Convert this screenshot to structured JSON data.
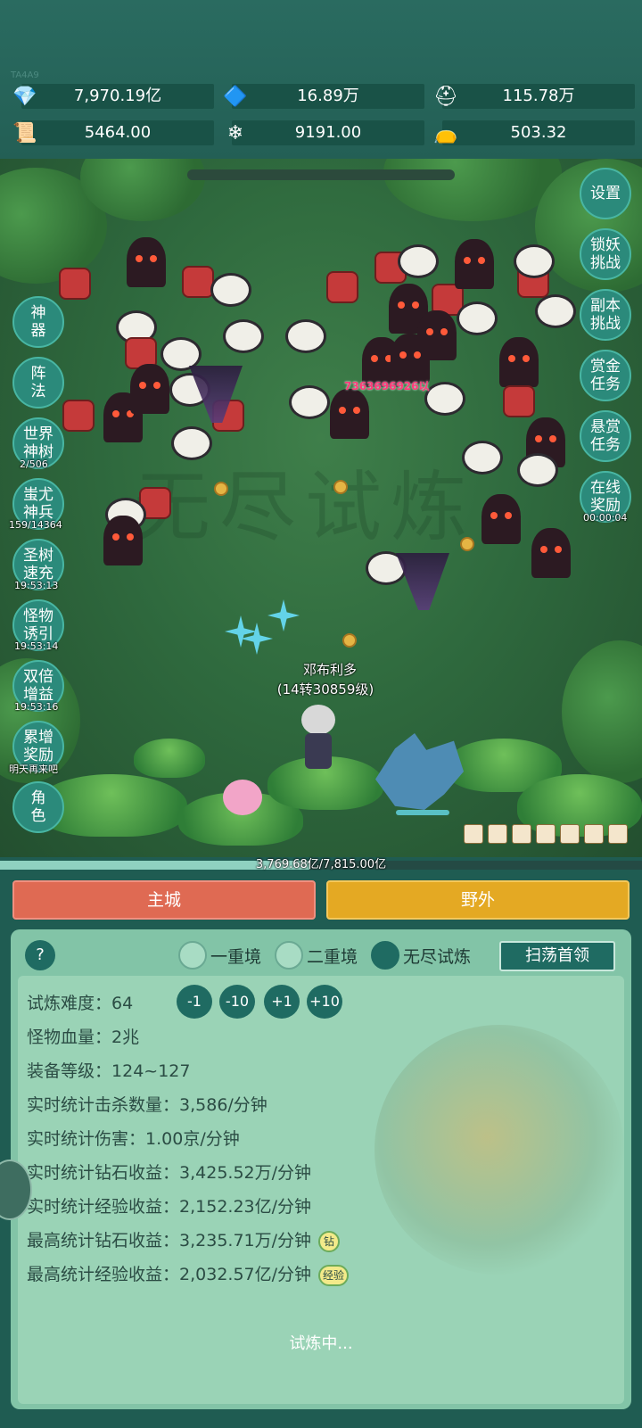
{
  "header": {
    "version": "TA4A9",
    "resources": [
      {
        "icon": "purple-gem-icon",
        "glyph": "💎",
        "value": "7,970.19亿"
      },
      {
        "icon": "blue-crystal-icon",
        "glyph": "🔷",
        "value": "16.89万"
      },
      {
        "icon": "helmet-icon",
        "glyph": "⛑",
        "value": "115.78万"
      },
      {
        "icon": "scroll-icon",
        "glyph": "📜",
        "value": "5464.00"
      },
      {
        "icon": "ice-crystal-icon",
        "glyph": "❄",
        "value": "9191.00"
      },
      {
        "icon": "purple-pouch-icon",
        "glyph": "👝",
        "value": "503.32"
      }
    ]
  },
  "scene": {
    "watermark": "无尽试炼",
    "damage_text": "7363696926以",
    "player": {
      "name": "邓布利多",
      "level": "(14转30859级)"
    },
    "left_buttons": [
      {
        "line1": "神",
        "line2": "器"
      },
      {
        "line1": "阵",
        "line2": "法"
      },
      {
        "line1": "世界",
        "line2": "神树",
        "timer": "2/506"
      },
      {
        "line1": "蚩尤",
        "line2": "神兵",
        "timer": "159/14364"
      },
      {
        "line1": "圣树",
        "line2": "速充",
        "timer": "19:53:13"
      },
      {
        "line1": "怪物",
        "line2": "诱引",
        "timer": "19:53:14"
      },
      {
        "line1": "双倍",
        "line2": "增益",
        "timer": "19:53:16"
      },
      {
        "line1": "累增",
        "line2": "奖励",
        "timer": "明天再来吧"
      },
      {
        "line1": "角",
        "line2": "色"
      }
    ],
    "right_buttons": [
      {
        "line1": "设置",
        "line2": ""
      },
      {
        "line1": "锁妖",
        "line2": "挑战"
      },
      {
        "line1": "副本",
        "line2": "挑战"
      },
      {
        "line1": "赏金",
        "line2": "任务"
      },
      {
        "line1": "悬赏",
        "line2": "任务"
      },
      {
        "line1": "在线",
        "line2": "奖励",
        "timer": "00:00:04"
      }
    ],
    "exp_progress": 0.482,
    "exp_text": "3,769.68亿/7,815.00亿"
  },
  "nav": {
    "main_city": "主城",
    "wild": "野外"
  },
  "trial": {
    "help": "?",
    "modes": [
      "一重境",
      "二重境",
      "无尽试炼"
    ],
    "selected_mode": "无尽试炼",
    "sweep_button": "扫荡首领",
    "steps": [
      "-1",
      "-10",
      "+1",
      "+10"
    ],
    "stats": [
      {
        "label": "试炼难度：",
        "value": "64"
      },
      {
        "label": "怪物血量：",
        "value": "2兆"
      },
      {
        "label": "装备等级：",
        "value": "124~127"
      },
      {
        "label": "实时统计击杀数量：",
        "value": "3,586/分钟"
      },
      {
        "label": "实时统计伤害：",
        "value": "1.00京/分钟"
      },
      {
        "label": "实时统计钻石收益：",
        "value": "3,425.52万/分钟"
      },
      {
        "label": "实时统计经验收益：",
        "value": "2,152.23亿/分钟"
      },
      {
        "label": "最高统计钻石收益：",
        "value": "3,235.71万/分钟",
        "badge": "钻"
      },
      {
        "label": "最高统计经验收益：",
        "value": "2,032.57亿/分钟",
        "badge": "经验"
      }
    ],
    "status": "试炼中..."
  }
}
